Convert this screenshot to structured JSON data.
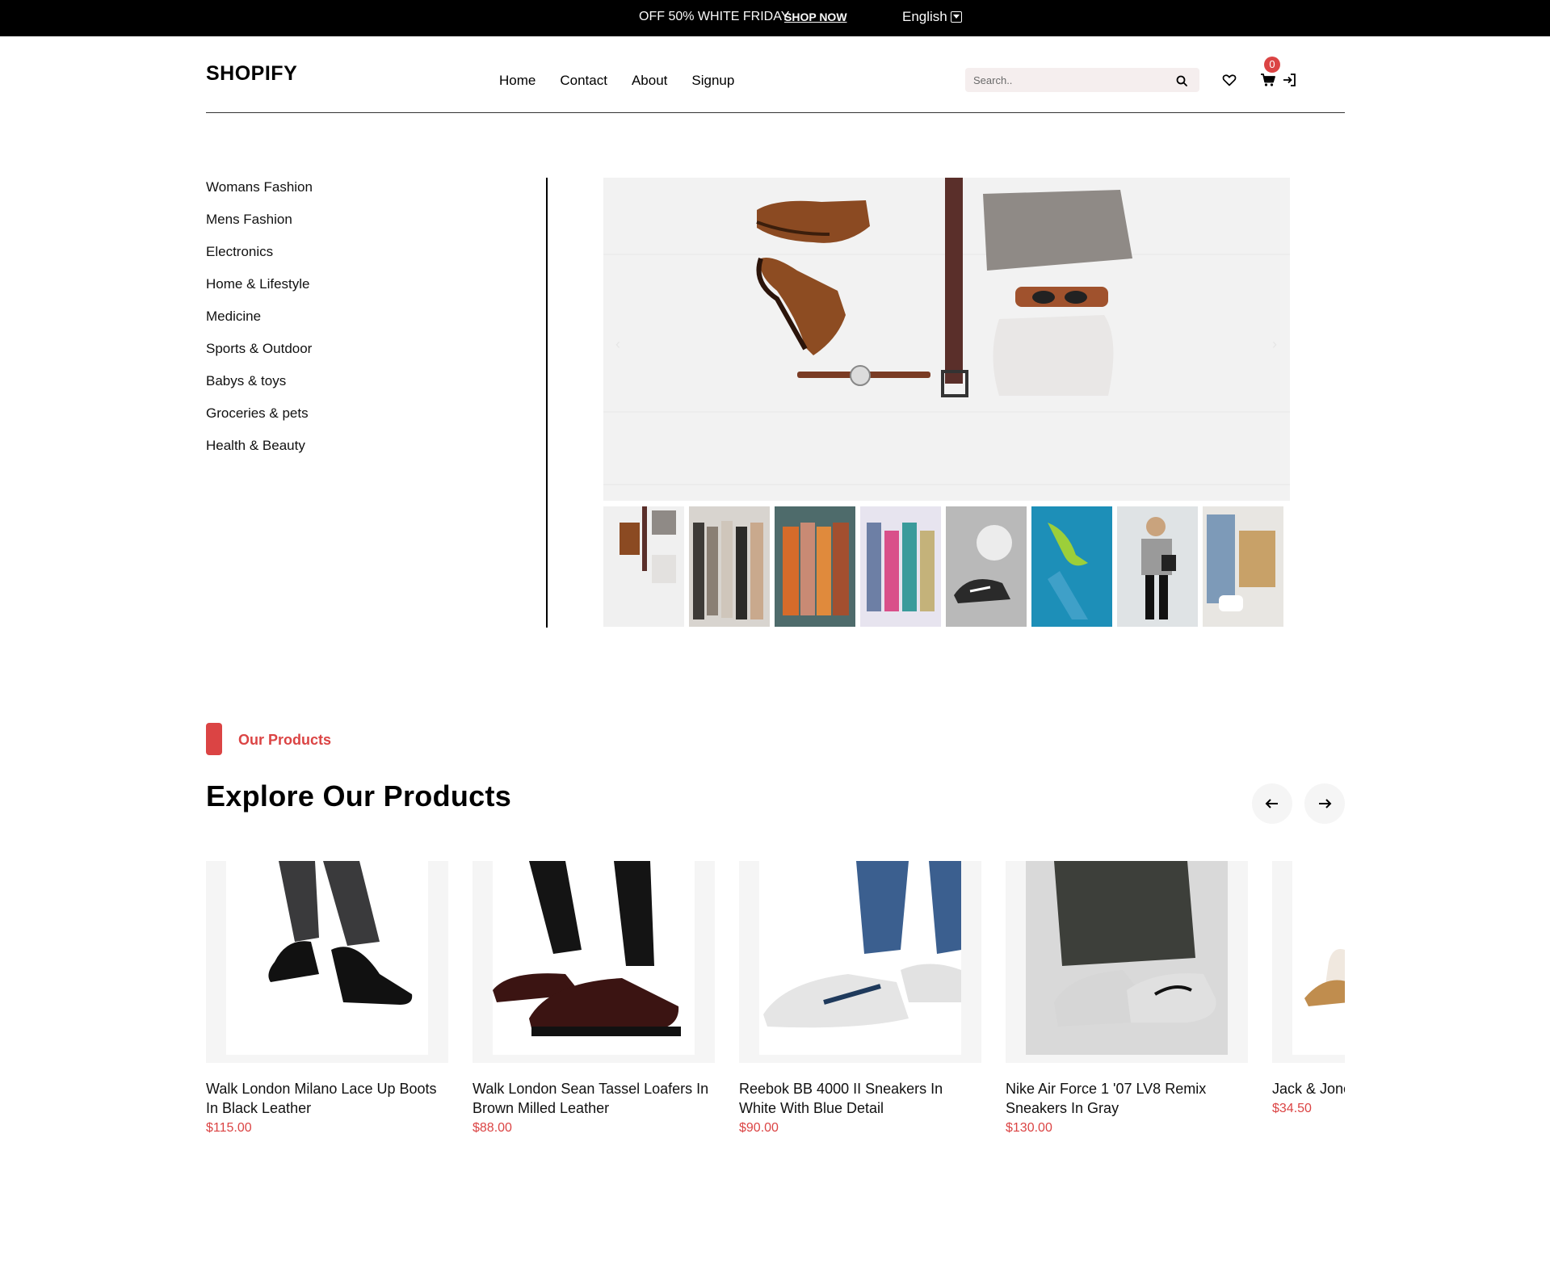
{
  "topbar": {
    "promo": "OFF 50% WHITE FRIDAY",
    "shop_link": "SHOP NOW",
    "language": "English"
  },
  "header": {
    "logo": "SHOPIFY",
    "nav": [
      "Home",
      "Contact",
      "About",
      "Signup"
    ],
    "search_placeholder": "Search..",
    "cart_count": "0",
    "icons": [
      "search-icon",
      "heart-icon",
      "cart-icon",
      "login-icon"
    ]
  },
  "categories": [
    "Womans Fashion",
    "Mens Fashion",
    "Electronics",
    "Home & Lifestyle",
    "Medicine",
    "Sports & Outdoor",
    "Babys & toys",
    "Groceries & pets",
    "Health & Beauty"
  ],
  "hero": {
    "arrows": [
      "‹",
      "›"
    ],
    "thumbnail_count": 8
  },
  "section": {
    "tag": "Our Products",
    "title": "Explore Our Products"
  },
  "products": [
    {
      "name": "Walk London Milano Lace Up Boots In Black Leather",
      "price": "$115.00"
    },
    {
      "name": "Walk London Sean Tassel Loafers In Brown Milled Leather",
      "price": "$88.00"
    },
    {
      "name": "Reebok BB 4000 II Sneakers In White With Blue Detail",
      "price": "$90.00"
    },
    {
      "name": "Nike Air Force 1 '07 LV8 Remix Sneakers In Gray",
      "price": "$130.00"
    },
    {
      "name": "Jack & Jones Slippers In",
      "price": "$34.50"
    }
  ],
  "colors": {
    "accent": "#db4444",
    "topbar_bg": "#000000",
    "search_bg": "#f5eeee"
  }
}
